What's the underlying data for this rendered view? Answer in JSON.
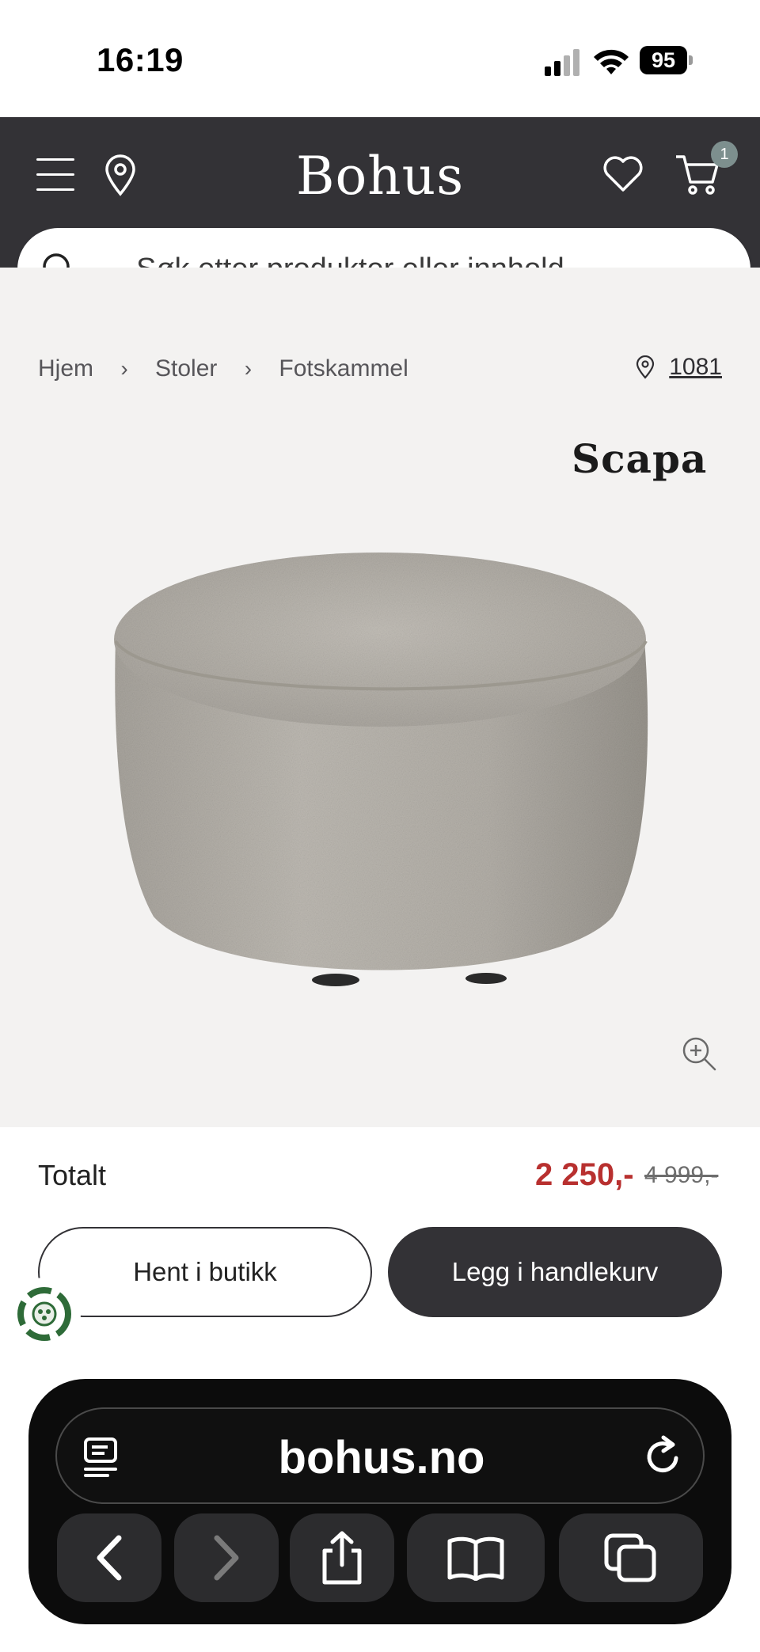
{
  "status_bar": {
    "time": "16:19",
    "battery": "95"
  },
  "header": {
    "logo": "Bohus",
    "cart_count": "1"
  },
  "search": {
    "placeholder": "Søk etter produkter eller innhold ..."
  },
  "breadcrumb": {
    "items": [
      "Hjem",
      "Stoler",
      "Fotskammel"
    ],
    "store": "1081"
  },
  "product": {
    "brand": "Scapa",
    "fabric_color": "#b9b5ae"
  },
  "panel": {
    "total_label": "Totalt",
    "price": "2 250,-",
    "old_price": "4 999,-",
    "pickup_label": "Hent i butikk",
    "add_to_cart_label": "Legg i handlekurv"
  },
  "browser": {
    "url": "bohus.no"
  },
  "colors": {
    "header": "#333236",
    "sale": "#b8302f",
    "page_bg": "#f3f2f1"
  }
}
